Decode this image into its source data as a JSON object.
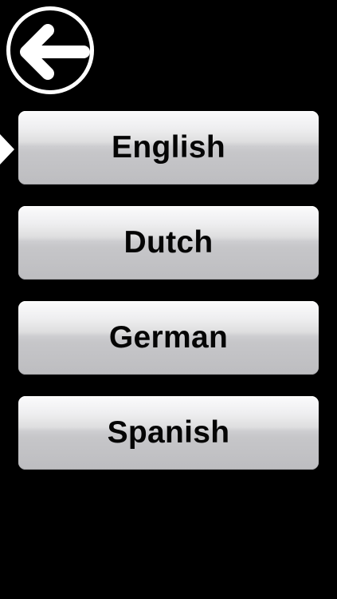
{
  "header": {
    "back_icon": "arrow-left-icon"
  },
  "languages": {
    "selected": "English",
    "items": [
      {
        "label": "English"
      },
      {
        "label": "Dutch"
      },
      {
        "label": "German"
      },
      {
        "label": "Spanish"
      }
    ]
  },
  "colors": {
    "background": "#000000",
    "button_top": "#fbfbfc",
    "button_bottom": "#bdbdc0",
    "text": "#050505",
    "icon": "#ffffff"
  }
}
